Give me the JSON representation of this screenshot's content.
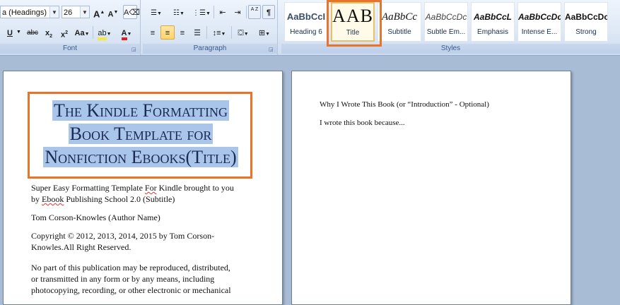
{
  "font": {
    "name_value": "a (Headings)",
    "size_value": "26",
    "group_label": "Font",
    "buttons": [
      "A",
      "A",
      "U",
      "abc",
      "x",
      "x",
      "Aa"
    ]
  },
  "paragraph": {
    "group_label": "Paragraph",
    "sort_label": "A Z",
    "pilcrow": "¶"
  },
  "styles": {
    "group_label": "Styles",
    "items": [
      {
        "preview": "AaBbCcI",
        "name": "Heading 6"
      },
      {
        "preview": "AAB",
        "name": "Title"
      },
      {
        "preview": "AaBbCc",
        "name": "Subtitle"
      },
      {
        "preview": "AaBbCcDc",
        "name": "Subtle Em..."
      },
      {
        "preview": "AaBbCcL",
        "name": "Emphasis"
      },
      {
        "preview": "AaBbCcDc",
        "name": "Intense E..."
      },
      {
        "preview": "AaBbCcDc",
        "name": "Strong"
      }
    ]
  },
  "colors": {
    "highlight_orange": "#e8742a",
    "selection_blue": "#a9c5ea",
    "font_color_red": "#e02020",
    "highlight_yellow": "#f5e93a"
  },
  "page1": {
    "title_lines": [
      "The Kindle Formatting",
      "Book Template for",
      "Nonfiction Ebooks(Title)"
    ],
    "subtitle_a": "Super Easy Formatting Template ",
    "subtitle_for": "For",
    "subtitle_b": " Kindle brought to you",
    "subtitle_c": "by ",
    "subtitle_ebook": "Ebook",
    "subtitle_d": " Publishing School 2.0 (Subtitle)",
    "author": "Tom Corson-Knowles (Author Name)",
    "copyright_1": "Copyright © 2012, 2013, 2014, 2015 by Tom Corson-",
    "copyright_2": "Knowles.All Right Reserved.",
    "rights_1": "No part of this publication may be reproduced, distributed,",
    "rights_2": "or transmitted in any form or by any means, including",
    "rights_3": "photocopying, recording, or other electronic or mechanical"
  },
  "page2": {
    "heading": "Why I Wrote This Book (or “Introduction” - Optional)",
    "body": "I wrote this book because..."
  }
}
